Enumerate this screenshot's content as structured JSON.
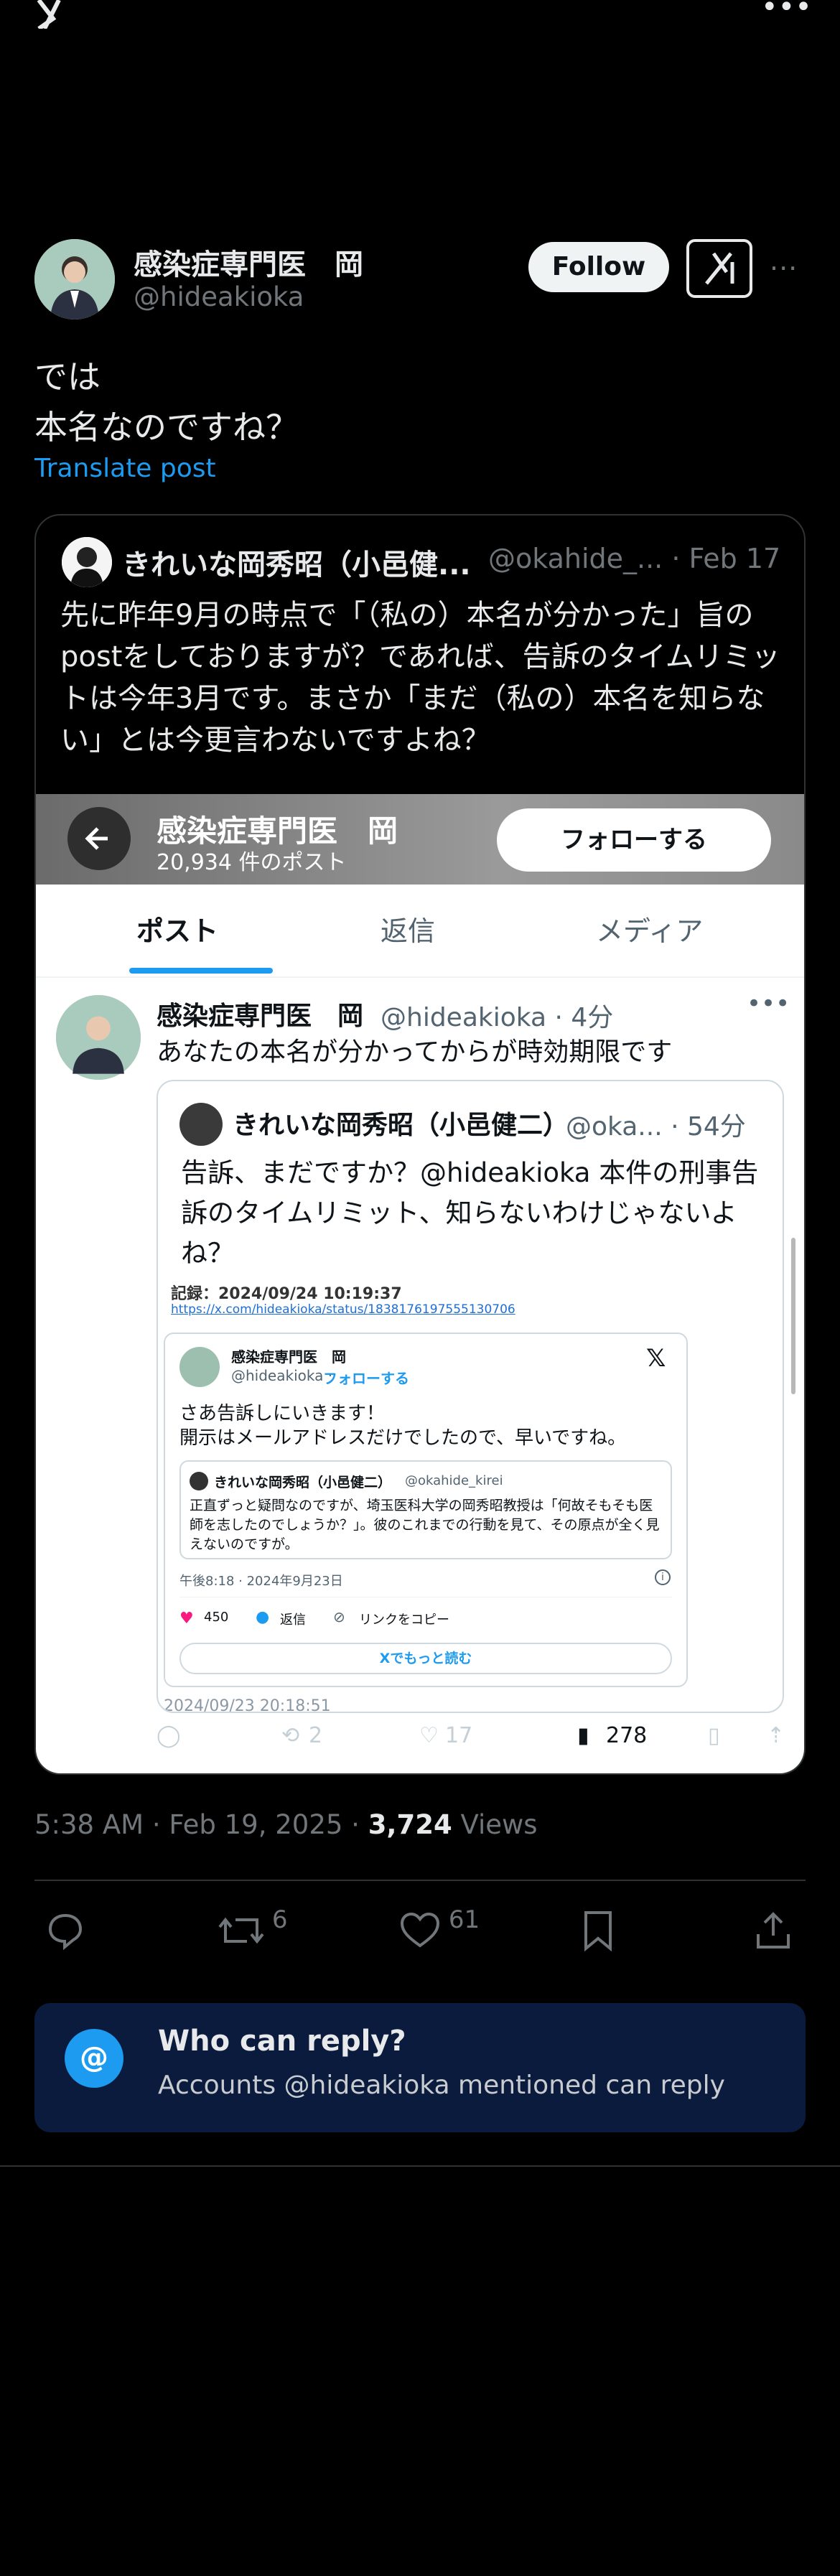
{
  "post": {
    "author_name": "感染症専門医　岡",
    "author_handle": "@hideakioka",
    "follow_label": "Follow",
    "text_line1": "では",
    "text_line2": "本名なのですね？",
    "translate_label": "Translate post",
    "timestamp": "5:38 AM · Feb 19, 2025 · ",
    "views_count": "3,724",
    "views_label": " Views",
    "retweets": "6",
    "likes": "61"
  },
  "quote": {
    "author_name": "きれいな岡秀昭（小邑健...",
    "author_handle": "@okahide_... · Feb 17",
    "text": "先に昨年9月の時点で「（私の）本名が分かった」旨のpostをしておりますが？であれば、告訴のタイムリミットは今年3月です。まさか「まだ（私の）本名を知らない」とは今更言わないですよね？",
    "screenshot": {
      "profile_name": "感染症専門医　岡",
      "post_count": "20,934 件のポスト",
      "follow_label": "フォローする",
      "tabs": [
        "ポスト",
        "返信",
        "メディア"
      ],
      "post_author": "感染症専門医　岡",
      "post_handle": "@hideakioka · 4分",
      "post_text": "あなたの本名が分かってからが時効期限です",
      "inner_author": "きれいな岡秀昭（小邑健二）",
      "inner_handle": "@oka... · 54分",
      "inner_text": "告訴、まだですか？@hideakioka 本件の刑事告訴のタイムリミット、知らないわけじゃないよね？",
      "record_label": "記録：2024/09/24 10:19:37",
      "record_url": "https://x.com/hideakioka/status/1838176197555130706",
      "card_name": "感染症専門医　岡",
      "card_handle": "@hideakioka ·",
      "card_follow": "フォローする",
      "card_text_line1": "さあ告訴しにいきます！",
      "card_text_line2": "開示はメールアドレスだけでしたので、早いですね。",
      "card_inner_name": "きれいな岡秀昭（小邑健二）",
      "card_inner_handle": "@okahide_kirei",
      "card_inner_text": "正直ずっと疑問なのですが、埼玉医科大学の岡秀昭教授は「何故そもそも医師を志したのでしょうか？」。彼のこれまでの行動を見て、その原点が全く見えないのですが。",
      "card_time": "午後8:18 · 2024年9月23日",
      "card_likes": "450",
      "card_reply": "返信",
      "card_copy": "リンクをコピー",
      "card_more": "Xでもっと読む",
      "capture_time": "2024/09/23 20:18:51",
      "retweets": "2",
      "likes": "17",
      "views": "278"
    }
  },
  "reply_box": {
    "title": "Who can reply?",
    "subtitle": "Accounts @hideakioka mentioned can reply"
  },
  "colors": {
    "accent": "#1d9bf0",
    "background": "#000000",
    "reply_box_bg": "#0a1b3d"
  }
}
